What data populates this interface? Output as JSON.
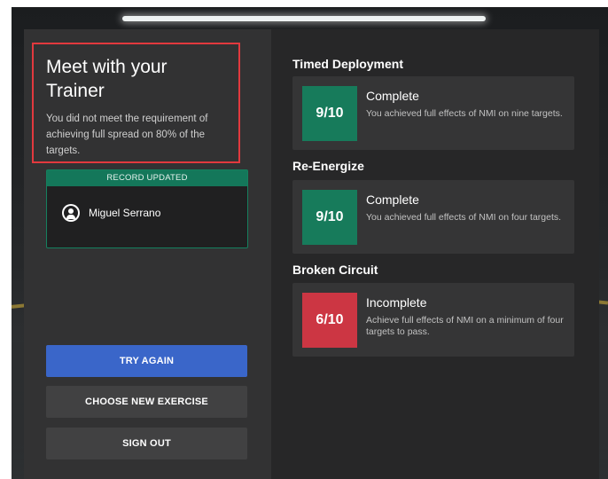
{
  "trainer": {
    "title": "Meet with your Trainer",
    "message": "You did not meet the requirement of achieving full spread on 80% of the targets."
  },
  "record": {
    "banner": "RECORD UPDATED",
    "user_name": "Miguel Serrano",
    "user_icon": "user-circle-icon"
  },
  "actions": {
    "try_again": "TRY AGAIN",
    "choose_new": "CHOOSE NEW EXERCISE",
    "sign_out": "SIGN OUT"
  },
  "results": [
    {
      "section": "Timed Deployment",
      "score": "9/10",
      "status": "Complete",
      "description": "You achieved full effects of NMI on nine targets.",
      "state": "complete"
    },
    {
      "section": "Re-Energize",
      "score": "9/10",
      "status": "Complete",
      "description": "You achieved full effects of NMI on four targets.",
      "state": "complete"
    },
    {
      "section": "Broken Circuit",
      "score": "6/10",
      "status": "Incomplete",
      "description": "Achieve full effects of NMI on a minimum of four targets to pass.",
      "state": "incomplete"
    }
  ],
  "colors": {
    "highlight_border": "#e2393e",
    "complete": "#177b5b",
    "incomplete": "#cc3643",
    "primary_button": "#3a66c9",
    "record_banner": "#14775a"
  }
}
